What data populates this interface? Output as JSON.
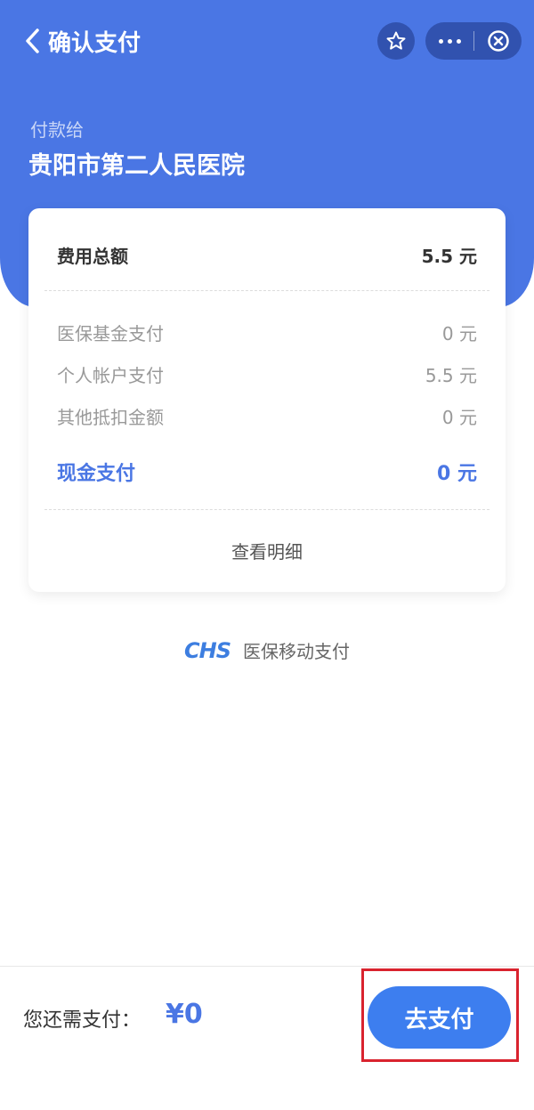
{
  "header": {
    "title": "确认支付",
    "back_icon": "chevron-left-icon",
    "star_icon": "star-icon",
    "more_icon": "more-dots-icon",
    "close_icon": "close-circle-icon",
    "payee_label": "付款给",
    "payee_name": "贵阳市第二人民医院"
  },
  "summary": {
    "total_label": "费用总额",
    "total_value": "5.5 元",
    "items": [
      {
        "label": "医保基金支付",
        "value": "0 元"
      },
      {
        "label": "个人帐户支付",
        "value": "5.5 元"
      },
      {
        "label": "其他抵扣金额",
        "value": "0 元"
      }
    ],
    "cash_label": "现金支付",
    "cash_value": "0 元",
    "view_detail": "查看明细"
  },
  "brand": {
    "logo_text": "CHS",
    "text": "医保移动支付"
  },
  "footer": {
    "need_label": "您还需支付：",
    "need_amount": "¥0",
    "pay_button": "去支付"
  },
  "colors": {
    "primary": "#4a76e4",
    "button": "#3d7eef",
    "highlight": "#d9232e"
  }
}
